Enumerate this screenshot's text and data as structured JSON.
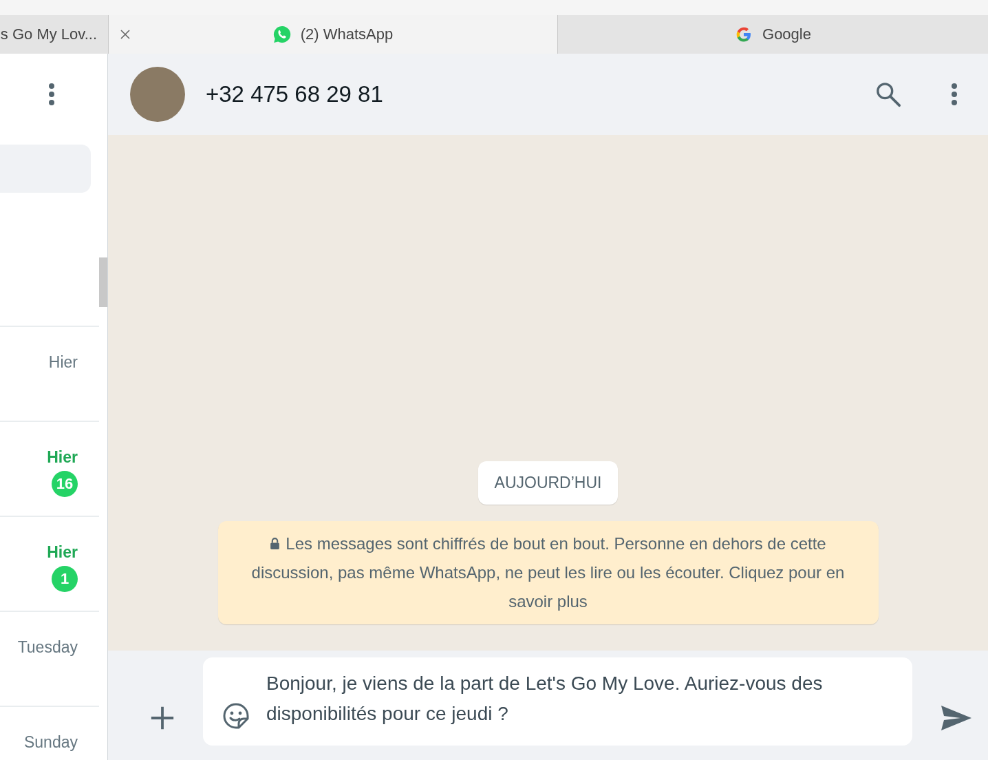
{
  "browser_tabs": [
    {
      "label": "s Go My Lov...",
      "selected": false,
      "kind": "plain",
      "closable": false
    },
    {
      "label": "(2) WhatsApp",
      "selected": true,
      "kind": "whatsapp",
      "closable": true
    },
    {
      "label": "Google",
      "selected": false,
      "kind": "google",
      "closable": false
    }
  ],
  "chat_list": [
    {
      "time": "Hier",
      "unread": false
    },
    {
      "time": "Hier",
      "unread": true,
      "badge": "16"
    },
    {
      "time": "Hier",
      "unread": true,
      "badge": "1"
    },
    {
      "time": "Tuesday",
      "unread": false
    },
    {
      "time": "Sunday",
      "unread": false
    }
  ],
  "conversation": {
    "contact": "+32 475 68 29 81",
    "date_chip": "AUJOURD’HUI",
    "notice": "Les messages sont chiffrés de bout en bout. Personne en dehors de cette discussion, pas même WhatsApp, ne peut les lire ou les écouter. Cliquez pour en savoir plus",
    "composer": {
      "value": "Bonjour, je viens de la part de Let's Go My Love. Auriez-vous des disponibilités pour ce jeudi ?"
    }
  }
}
